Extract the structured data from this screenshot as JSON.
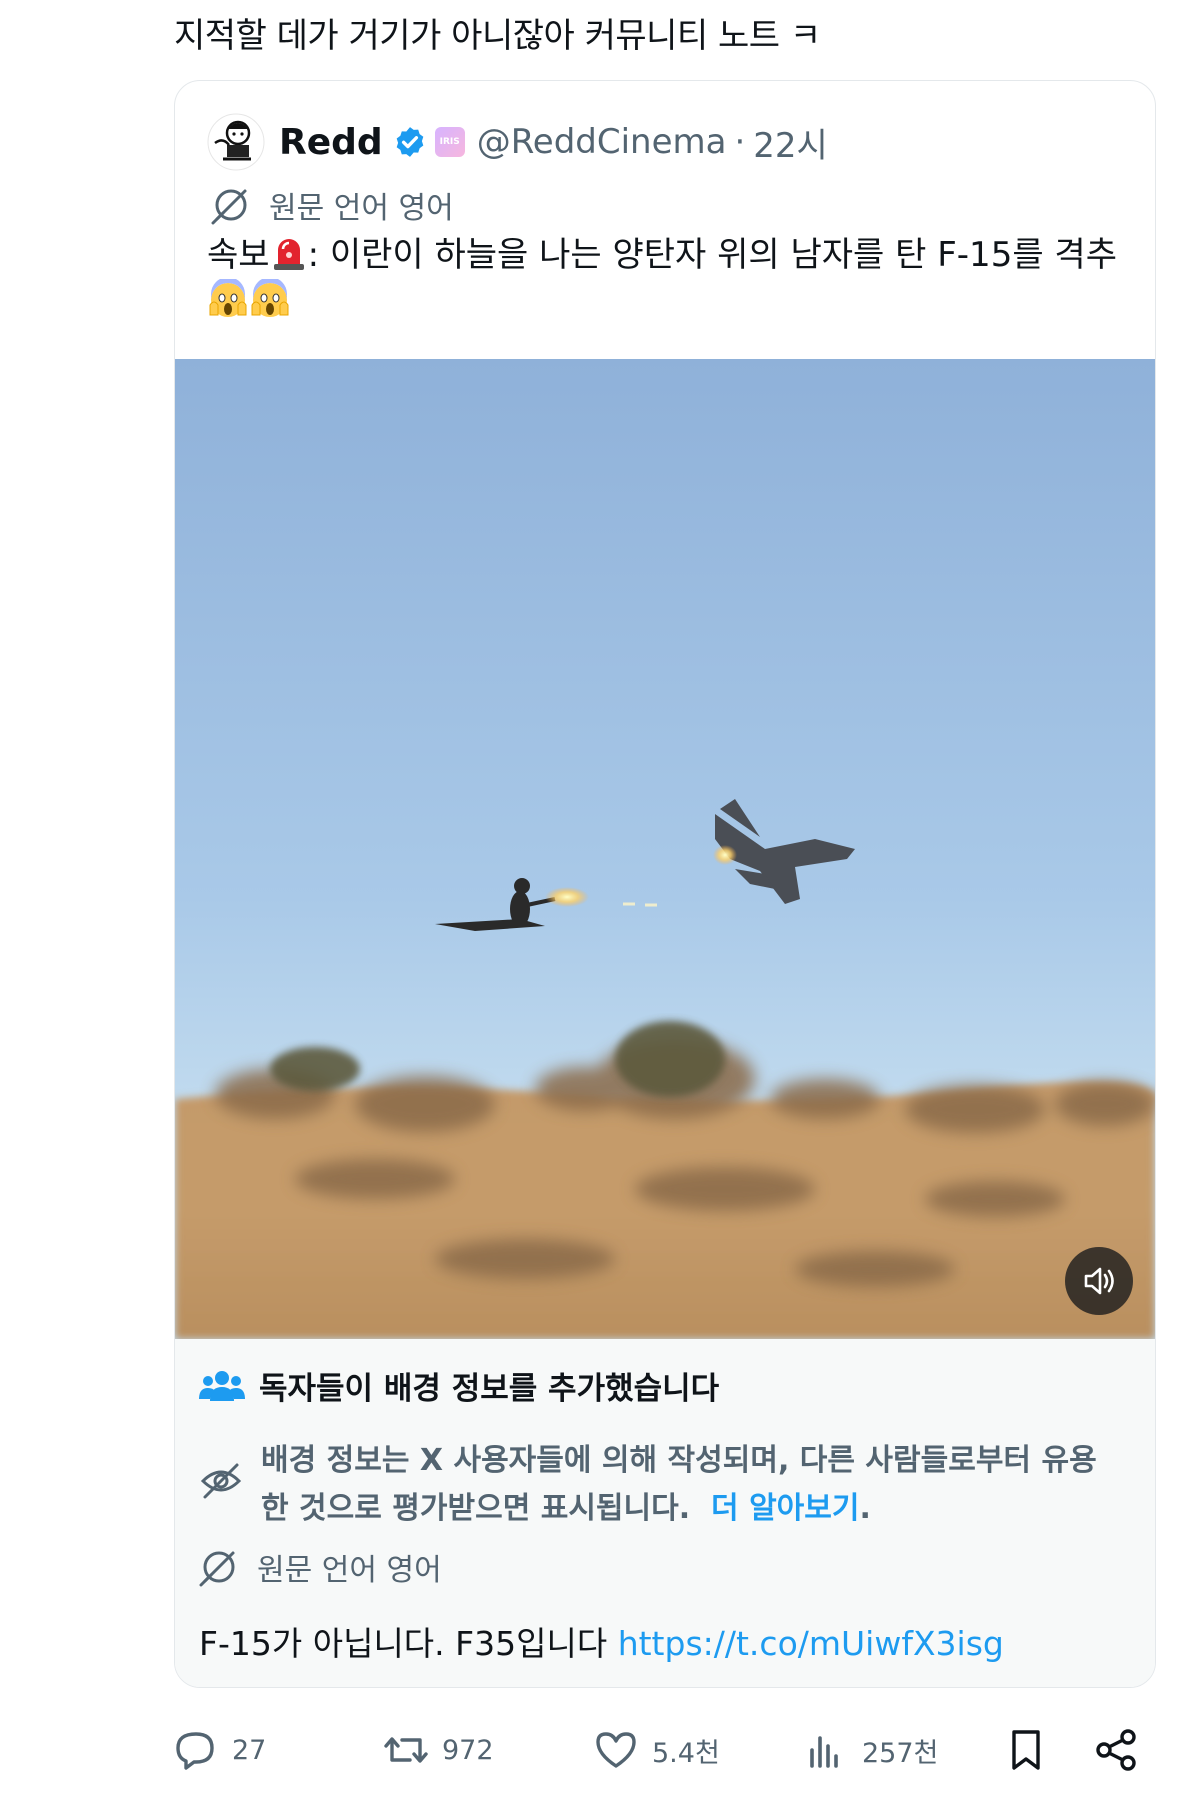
{
  "post": {
    "text": "지적할 데가 거기가 아니잖아 커뮤니티 노트 ㅋ"
  },
  "quote": {
    "display_name": "Redd",
    "affiliate_badge_text": "IRIS",
    "handle": "@ReddCinema",
    "separator": "·",
    "time": "22시",
    "translate_label": "원문 언어 영어",
    "body_prefix": "속보",
    "body_text": ": 이란이 하늘을 나는 양탄자 위의 남자를 탄 F-15를 격추",
    "icons": {
      "alert": "rotating-light-emoji",
      "scream": "scream-emoji",
      "verified": "verified-badge-icon",
      "translate": "translate-icon",
      "sound": "speaker-icon"
    }
  },
  "community_note": {
    "title": "독자들이 배경 정보를 추가했습니다",
    "description": "배경 정보는 X 사용자들에 의해 작성되며, 다른 사람들로부터 유용한 것으로 평가받으면 표시됩니다.",
    "learn_more": "더 알아보기",
    "learn_more_suffix": ".",
    "translate_label": "원문 언어 영어",
    "body_text": "F-15가 아닙니다. F35입니다",
    "link_text": "https://t.co/mUiwfX3isg",
    "accent": "#1d9bf0"
  },
  "actions": {
    "reply_count": "27",
    "repost_count": "972",
    "like_count": "5.4천",
    "view_count": "257천"
  }
}
